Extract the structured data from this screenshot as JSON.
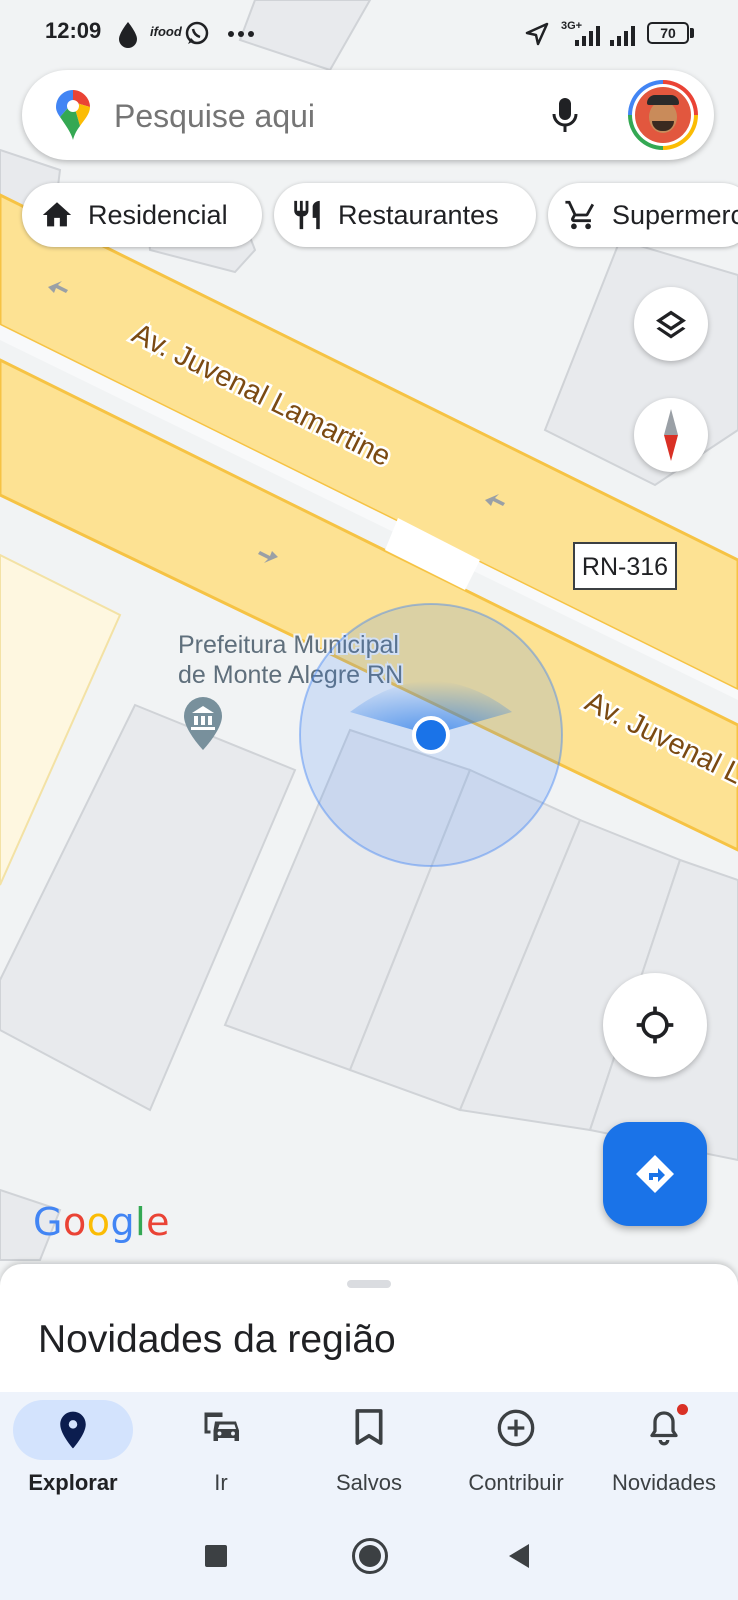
{
  "status_bar": {
    "time": "12:09",
    "notification_icons": [
      "drop-icon",
      "ifood-icon",
      "whatsapp-icon",
      "more-dots-icon"
    ],
    "ifood_label": "ifood",
    "network_label": "3G+",
    "battery": "70"
  },
  "search": {
    "placeholder": "Pesquise aqui",
    "icons": [
      "maps-pin-logo-icon",
      "microphone-icon",
      "avatar"
    ]
  },
  "chips": [
    {
      "label": "Residencial",
      "icon": "home-icon"
    },
    {
      "label": "Restaurantes",
      "icon": "restaurant-icon"
    },
    {
      "label": "Supermerc",
      "icon": "cart-icon"
    }
  ],
  "map": {
    "streets": [
      {
        "name": "Av. Juvenal Lamartine"
      },
      {
        "name": "Av. Juvenal L"
      }
    ],
    "route_shield": "RN-316",
    "poi": {
      "line1": "Prefeitura Municipal",
      "line2": "de Monte Alegre RN",
      "icon": "government-building-icon"
    },
    "google_logo": "Google",
    "colors": {
      "road": "#fde293",
      "road_edge": "#f6c344",
      "land": "#f1f3f4",
      "location": "#1a73e8"
    }
  },
  "map_buttons": [
    "layers-icon",
    "compass-icon",
    "my-location-icon",
    "directions-icon"
  ],
  "sheet": {
    "title": "Novidades da região"
  },
  "nav": {
    "items": [
      {
        "label": "Explorar",
        "icon": "explore-pin-icon",
        "active": true
      },
      {
        "label": "Ir",
        "icon": "commute-icon",
        "active": false
      },
      {
        "label": "Salvos",
        "icon": "bookmark-icon",
        "active": false
      },
      {
        "label": "Contribuir",
        "icon": "add-circle-icon",
        "active": false
      },
      {
        "label": "Novidades",
        "icon": "bell-icon",
        "active": false
      }
    ]
  },
  "system_nav": [
    "recents-icon",
    "home-icon",
    "back-icon"
  ]
}
